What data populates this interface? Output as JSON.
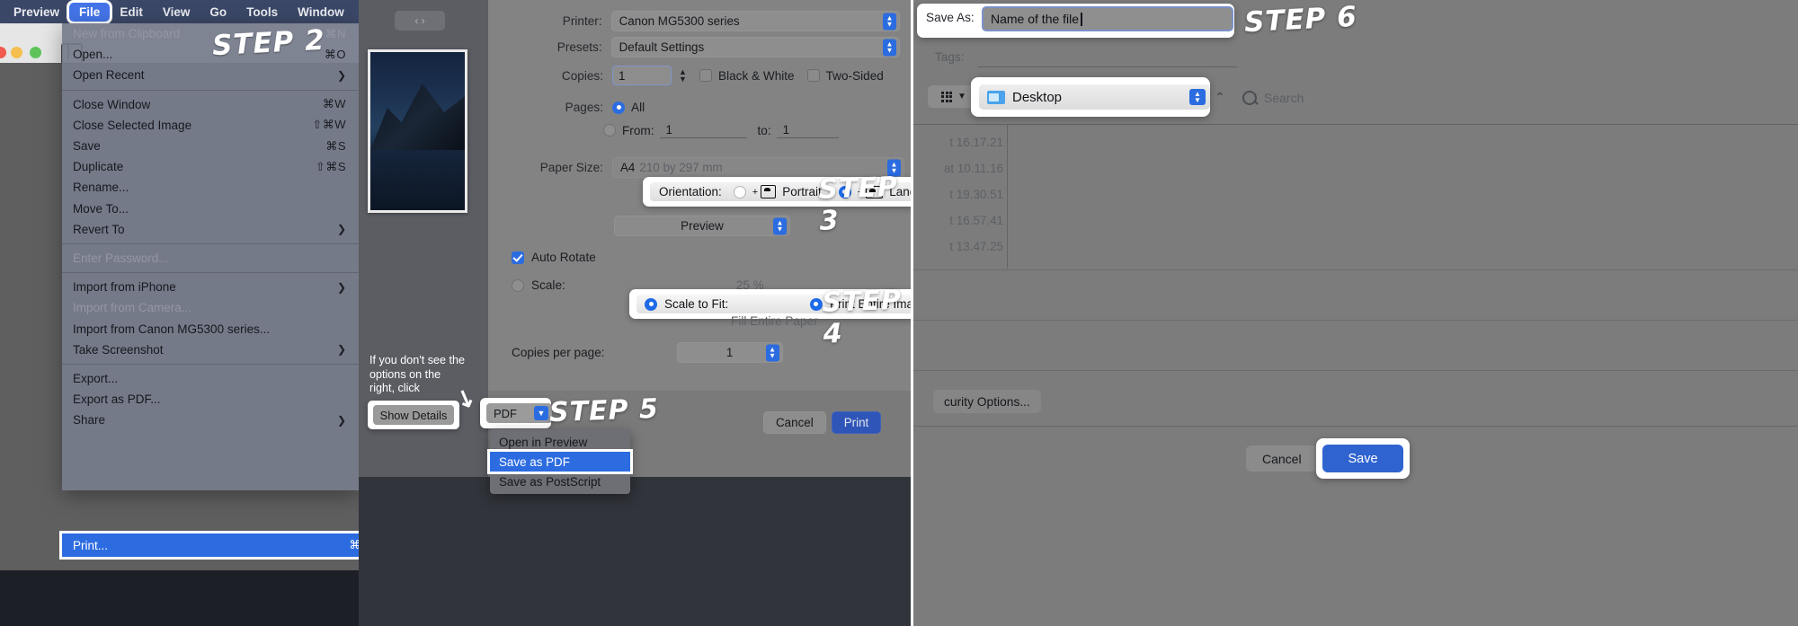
{
  "panel1": {
    "menubar": [
      {
        "label": "Preview",
        "selected": false
      },
      {
        "label": "File",
        "selected": true
      },
      {
        "label": "Edit",
        "selected": false
      },
      {
        "label": "View",
        "selected": false
      },
      {
        "label": "Go",
        "selected": false
      },
      {
        "label": "Tools",
        "selected": false
      },
      {
        "label": "Window",
        "selected": false
      }
    ],
    "step_badge": "STEP 2",
    "file_menu": [
      {
        "label": "New from Clipboard",
        "shortcut": "⌘N",
        "disabled": true,
        "submenu": false
      },
      {
        "label": "Open...",
        "shortcut": "⌘O",
        "disabled": false,
        "submenu": false
      },
      {
        "label": "Open Recent",
        "shortcut": "",
        "disabled": false,
        "submenu": true
      },
      {
        "separator": true
      },
      {
        "label": "Close Window",
        "shortcut": "⌘W",
        "disabled": false,
        "submenu": false
      },
      {
        "label": "Close Selected Image",
        "shortcut": "⇧⌘W",
        "disabled": false,
        "submenu": false
      },
      {
        "label": "Save",
        "shortcut": "⌘S",
        "disabled": false,
        "submenu": false
      },
      {
        "label": "Duplicate",
        "shortcut": "⇧⌘S",
        "disabled": false,
        "submenu": false
      },
      {
        "label": "Rename...",
        "shortcut": "",
        "disabled": false,
        "submenu": false
      },
      {
        "label": "Move To...",
        "shortcut": "",
        "disabled": false,
        "submenu": false
      },
      {
        "label": "Revert To",
        "shortcut": "",
        "disabled": false,
        "submenu": true
      },
      {
        "separator": true
      },
      {
        "label": "Enter Password...",
        "shortcut": "",
        "disabled": true,
        "submenu": false
      },
      {
        "separator": true
      },
      {
        "label": "Import from iPhone",
        "shortcut": "",
        "disabled": false,
        "submenu": true
      },
      {
        "label": "Import from Camera...",
        "shortcut": "",
        "disabled": true,
        "submenu": false
      },
      {
        "label": "Import from Canon MG5300 series...",
        "shortcut": "",
        "disabled": false,
        "submenu": false
      },
      {
        "label": "Take Screenshot",
        "shortcut": "",
        "disabled": false,
        "submenu": true
      },
      {
        "separator": true
      },
      {
        "label": "Export...",
        "shortcut": "",
        "disabled": false,
        "submenu": false
      },
      {
        "label": "Export as PDF...",
        "shortcut": "",
        "disabled": false,
        "submenu": false
      },
      {
        "label": "Share",
        "shortcut": "",
        "disabled": false,
        "submenu": true
      }
    ],
    "print_item": {
      "label": "Print...",
      "shortcut": "⌘P"
    }
  },
  "panel2": {
    "nav_pill": "‹ ›",
    "printer": {
      "label": "Printer:",
      "value": "Canon MG5300 series"
    },
    "presets": {
      "label": "Presets:",
      "value": "Default Settings"
    },
    "copies": {
      "label": "Copies:",
      "value": "1"
    },
    "black_white": {
      "label": "Black & White",
      "checked": false
    },
    "two_sided": {
      "label": "Two-Sided",
      "checked": false
    },
    "pages": {
      "label": "Pages:",
      "all": "All",
      "all_selected": true,
      "from_label": "From:",
      "from_value": "1",
      "to_label": "to:",
      "to_value": "1",
      "range_selected": false
    },
    "paper_size": {
      "label": "Paper Size:",
      "value": "A4",
      "value_dim": "210 by 297 mm"
    },
    "orientation": {
      "label": "Orientation:",
      "portrait": "Portrait",
      "landscape": "Landscape",
      "selected": "Landscape"
    },
    "preview_popup": "Preview",
    "auto_rotate": {
      "label": "Auto Rotate",
      "checked": true
    },
    "scale": {
      "label": "Scale:",
      "value": "25 %",
      "selected": false
    },
    "scale_to_fit": {
      "label": "Scale to Fit:",
      "selected": true
    },
    "print_entire": {
      "label": "Print Entire Image",
      "selected": true
    },
    "fill_entire": {
      "label": "Fill Entire Paper",
      "selected": false
    },
    "copies_per_page": {
      "label": "Copies per page:",
      "value": "1"
    },
    "hint": "If you don't see the options on the right, click",
    "show_details": "Show Details",
    "pdf_button": "PDF",
    "pdf_menu": [
      {
        "label": "Open in Preview",
        "selected": false
      },
      {
        "label": "Save as PDF",
        "selected": true
      },
      {
        "label": "Save as PostScript",
        "selected": false
      }
    ],
    "cancel": "Cancel",
    "print": "Print",
    "step3_badge": "STEP 3",
    "step4_badge": "STEP 4",
    "step5_badge": "STEP 5"
  },
  "panel3": {
    "save_as": {
      "label": "Save As:",
      "value": "Name of the file"
    },
    "tags": {
      "label": "Tags:",
      "value": ""
    },
    "location": {
      "value": "Desktop"
    },
    "search": {
      "placeholder": "Search"
    },
    "file_dates": [
      "t 16.17.21",
      "at 10.11.16",
      "t 19.30.51",
      "t 16.57.41",
      "t 13.47.25"
    ],
    "security_options": "curity Options...",
    "cancel": "Cancel",
    "save": "Save",
    "step6_badge": "STEP 6"
  }
}
